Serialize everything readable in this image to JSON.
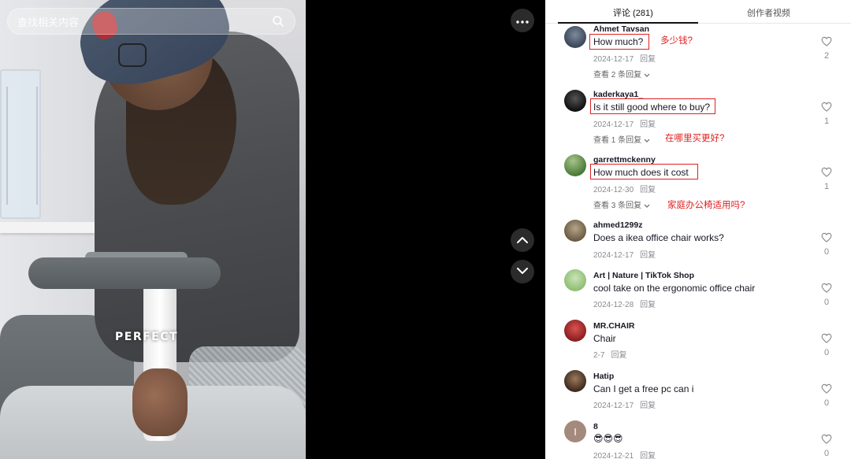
{
  "search": {
    "placeholder": "查找相关内容"
  },
  "video": {
    "overlay_text": "PERFECT"
  },
  "tabs": [
    {
      "label": "评论 (281)",
      "active": true
    },
    {
      "label": "创作者视频",
      "active": false
    }
  ],
  "comments": [
    {
      "username": "Ahmet Tavsan",
      "text": "How much?",
      "date": "2024-12-17",
      "reply": "回复",
      "view_replies": "查看 2 条回复",
      "likes": "2",
      "annotation": "多少钱?"
    },
    {
      "username": "kaderkaya1_",
      "text": "Is it still good where to buy?",
      "date": "2024-12-17",
      "reply": "回复",
      "view_replies": "查看 1 条回复",
      "likes": "1",
      "annotation": "在哪里买更好?"
    },
    {
      "username": "garrettmckenny",
      "text": "How much does it cost",
      "date": "2024-12-30",
      "reply": "回复",
      "view_replies": "查看 3 条回复",
      "likes": "1",
      "annotation": "家庭办公椅适用吗?"
    },
    {
      "username": "ahmed1299z",
      "text": "Does a ikea office chair works?",
      "date": "2024-12-17",
      "reply": "回复",
      "likes": "0"
    },
    {
      "username": "Art | Nature | TikTok Shop",
      "text": "cool take on the ergonomic office chair",
      "date": "2024-12-28",
      "reply": "回复",
      "likes": "0"
    },
    {
      "username": "MR.CHAIR",
      "text": "Chair",
      "date": "2-7",
      "reply": "回复",
      "likes": "0"
    },
    {
      "username": "Hatip",
      "text": "Can I get a free pc can i",
      "date": "2024-12-17",
      "reply": "回复",
      "likes": "0"
    },
    {
      "username": "8",
      "text": "😎😎😎",
      "date": "2024-12-21",
      "reply": "回复",
      "likes": "0",
      "avatar_letter": "I"
    }
  ],
  "colors": {
    "annotation_red": "#e02020",
    "panel_bg": "#ffffff",
    "stage_bg": "#000000"
  }
}
